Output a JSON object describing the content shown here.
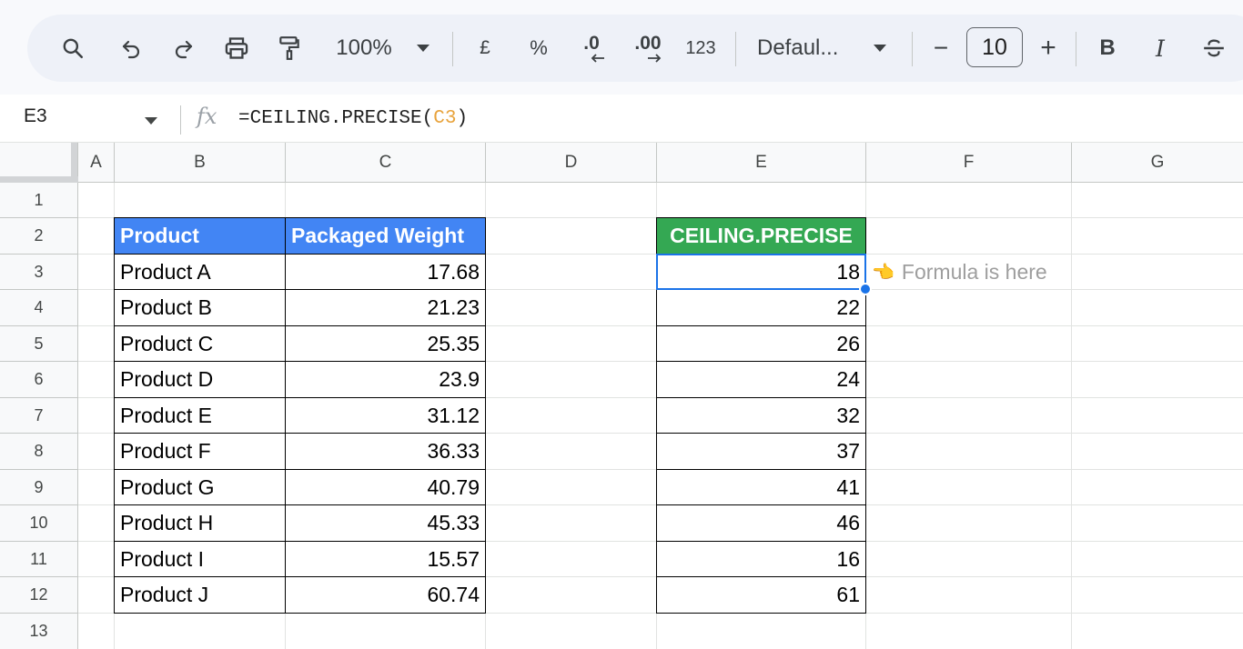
{
  "toolbar": {
    "zoom": "100%",
    "currency": "£",
    "percent": "%",
    "decrease_decimal": ".0",
    "increase_decimal": ".00",
    "number_format": "123",
    "font_name": "Defaul...",
    "font_size": "10",
    "decrease_font": "−",
    "increase_font": "+",
    "bold": "B",
    "italic": "I"
  },
  "formula_bar": {
    "name_box": "E3",
    "fx": "fx",
    "formula_prefix": "=CEILING.PRECISE(",
    "formula_ref": "C3",
    "formula_suffix": ")"
  },
  "columns": [
    "A",
    "B",
    "C",
    "D",
    "E",
    "F",
    "G"
  ],
  "rows": [
    "1",
    "2",
    "3",
    "4",
    "5",
    "6",
    "7",
    "8",
    "9",
    "10",
    "11",
    "12",
    "13"
  ],
  "table": {
    "header_product": "Product",
    "header_weight": "Packaged Weight",
    "header_result": "CEILING.PRECISE",
    "rows": [
      {
        "product": "Product A",
        "weight": "17.68",
        "result": "18"
      },
      {
        "product": "Product B",
        "weight": "21.23",
        "result": "22"
      },
      {
        "product": "Product C",
        "weight": "25.35",
        "result": "26"
      },
      {
        "product": "Product D",
        "weight": "23.9",
        "result": "24"
      },
      {
        "product": "Product E",
        "weight": "31.12",
        "result": "32"
      },
      {
        "product": "Product F",
        "weight": "36.33",
        "result": "37"
      },
      {
        "product": "Product G",
        "weight": "40.79",
        "result": "41"
      },
      {
        "product": "Product H",
        "weight": "45.33",
        "result": "46"
      },
      {
        "product": "Product I",
        "weight": "15.57",
        "result": "16"
      },
      {
        "product": "Product J",
        "weight": "60.74",
        "result": "61"
      }
    ]
  },
  "annotation": {
    "hand": "👈",
    "text": "Formula is here"
  },
  "colors": {
    "header_blue": "#4285f4",
    "header_green": "#34a853",
    "selection": "#1a73e8"
  }
}
